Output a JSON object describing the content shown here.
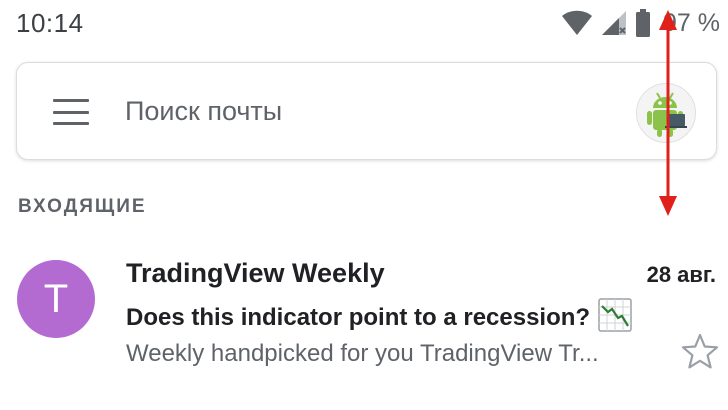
{
  "status_bar": {
    "time": "10:14",
    "battery_text": "97 %",
    "icons": [
      "wifi-icon",
      "cellular-signal-icon",
      "battery-icon"
    ]
  },
  "search": {
    "placeholder": "Поиск почты",
    "menu_icon": "hamburger-menu-icon",
    "account_avatar": "android-avatar"
  },
  "inbox": {
    "section_label": "ВХОДЯЩИЕ",
    "emails": [
      {
        "avatar_letter": "T",
        "avatar_color": "#b36bd1",
        "sender": "TradingView Weekly",
        "date": "28 авг.",
        "subject": "Does this indicator point to a recession?",
        "subject_emoji": "chart-decreasing-icon",
        "preview": "Weekly handpicked for you TradingView Tr...",
        "starred": false
      }
    ]
  },
  "annotation": {
    "type": "double-headed-arrow",
    "color": "#e0201b"
  },
  "colors": {
    "text_primary": "#202124",
    "text_secondary": "#5f6368",
    "card_border": "#dadce0"
  }
}
